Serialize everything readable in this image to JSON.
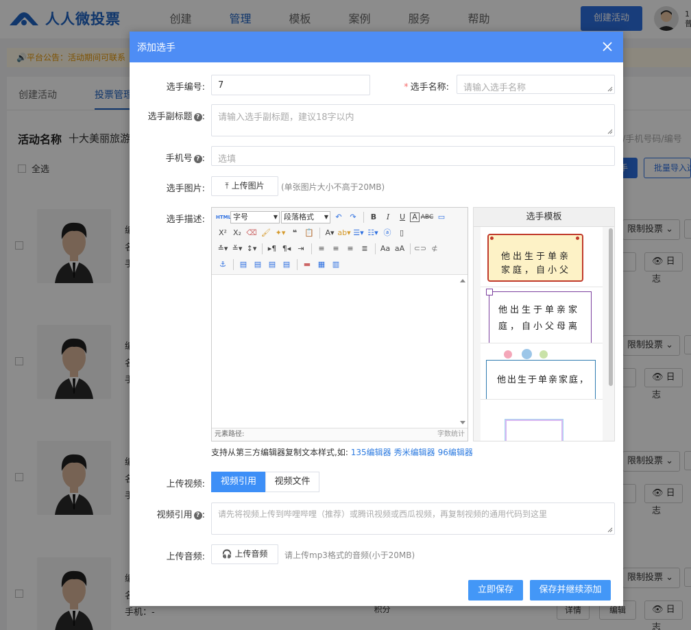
{
  "topbar": {
    "brand": "人人微投票",
    "nav": [
      "创建",
      "管理",
      "模板",
      "案例",
      "服务",
      "帮助"
    ],
    "create_button": "创建活动",
    "user_num": "1",
    "user_role": "普"
  },
  "notice": "🔊平台公告：活动期间可联系",
  "subtabs": [
    "创建活动",
    "投票管理"
  ],
  "activity": {
    "label": "活动名称",
    "name": "十大美丽旅游"
  },
  "select_all": "全选",
  "search_placeholder": "/手机号码/编号",
  "search_btn": "手",
  "import_btn": "批量导入选手",
  "cards": [
    {
      "r1": "编",
      "r2": "名",
      "r3": "手"
    },
    {
      "r1": "编",
      "r2": "名",
      "r3": "手"
    },
    {
      "r1": "编",
      "r2": "名",
      "r3": "手"
    },
    {
      "r1": "编",
      "r2": "名",
      "r3": "手机：-"
    }
  ],
  "card_actions": {
    "limit": "限制投票",
    "log": "日志",
    "detail": "详情",
    "edit": "编辑",
    "partial": "积分"
  },
  "modal": {
    "title": "添加选手",
    "fields": {
      "number_label": "选手编号:",
      "number_value": "7",
      "name_label": "选手名称:",
      "name_placeholder": "请输入选手名称",
      "subtitle_label": "选手副标题",
      "subtitle_placeholder": "请输入选手副标题，建议18字以内",
      "phone_label": "手机号",
      "phone_placeholder": "选填",
      "image_label": "选手图片:",
      "image_button": "上传图片",
      "image_hint": "(单张图片大小不高于20MB)",
      "desc_label": "选手描述:",
      "video_label": "上传视频:",
      "video_tabs": [
        "视频引用",
        "视频文件"
      ],
      "video_ref_label": "视频引用",
      "video_ref_placeholder": "请先将视频上传到哔哩哔哩（推荐）或腾讯视频或西瓜视频，再复制视频的通用代码到这里",
      "audio_label": "上传音频:",
      "audio_button": "上传音频",
      "audio_hint": "请上传mp3格式的音频(小于20MB)"
    },
    "editor": {
      "font_size": "字号",
      "paragraph": "段落格式",
      "path_label": "元素路径:",
      "count_label": "字数统计"
    },
    "template_panel": {
      "title": "选手模板",
      "items": [
        "他出生于单亲家庭，自小父母离",
        "他出生于单亲家庭，自小父母离",
        "他出生于单亲家庭，"
      ]
    },
    "support_text": "支持从第三方编辑器复制文本样式,如:",
    "support_links": [
      "135编辑器",
      "秀米编辑器",
      "96编辑器"
    ],
    "buttons": {
      "save": "立即保存",
      "save_continue": "保存并继续添加"
    }
  },
  "colors": {
    "brand": "#1e63c4",
    "modal_header": "#4e8df5",
    "primary_button": "#4397f7",
    "link": "#2d7be0"
  }
}
